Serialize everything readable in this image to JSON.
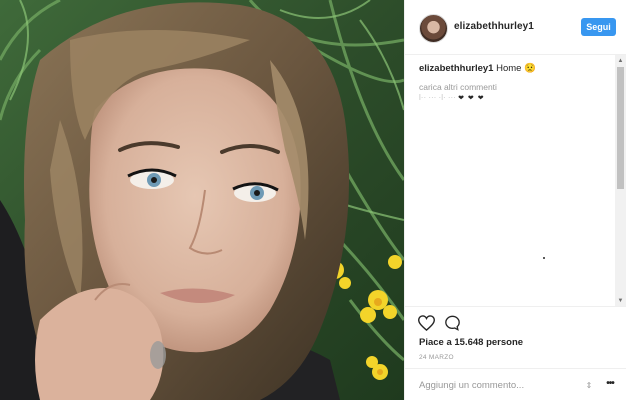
{
  "header": {
    "username": "elizabethhurley1",
    "follow_label": "Segui"
  },
  "caption": {
    "username": "elizabethhurley1",
    "text": "Home 😟"
  },
  "comments": {
    "load_more": "carica altri commenti",
    "partial_line": "l·· ··· ·l·  ···",
    "partial_hearts": "❤ ❤ ❤"
  },
  "stats": {
    "likes": "Piace a 15.648 persone",
    "date": "24 MARZO"
  },
  "comment_box": {
    "placeholder": "Aggiungi un commento..."
  },
  "icons": {
    "like": "heart-icon",
    "comment": "comment-icon",
    "more": "more-options-icon",
    "resize": "resize-icon"
  },
  "colors": {
    "accent": "#3897f0",
    "text": "#262626",
    "muted": "#999999"
  }
}
